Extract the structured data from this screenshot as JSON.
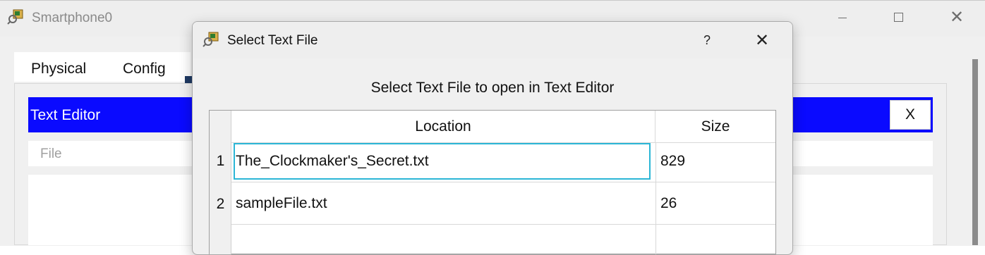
{
  "window": {
    "title": "Smartphone0",
    "controls": {
      "minimize": "minimize-icon",
      "maximize": "maximize-icon",
      "close_glyph": "✕"
    }
  },
  "tabs": [
    {
      "label": "Physical"
    },
    {
      "label": "Config"
    }
  ],
  "text_editor": {
    "title": "Text Editor",
    "close_label": "X",
    "menu": {
      "file_label": "File"
    }
  },
  "dialog": {
    "title": "Select Text File",
    "help_label": "?",
    "close_glyph": "✕",
    "heading": "Select Text File to open in Text Editor",
    "table": {
      "columns": [
        "Location",
        "Size"
      ],
      "rows": [
        {
          "num": "1",
          "location": "The_Clockmaker's_Secret.txt",
          "size": "829",
          "selected": true
        },
        {
          "num": "2",
          "location": "sampleFile.txt",
          "size": "26",
          "selected": false
        }
      ]
    }
  },
  "colors": {
    "header_blue": "#0a0aff",
    "selection_border": "#2bb6d6",
    "background": "#f0f0f0"
  }
}
